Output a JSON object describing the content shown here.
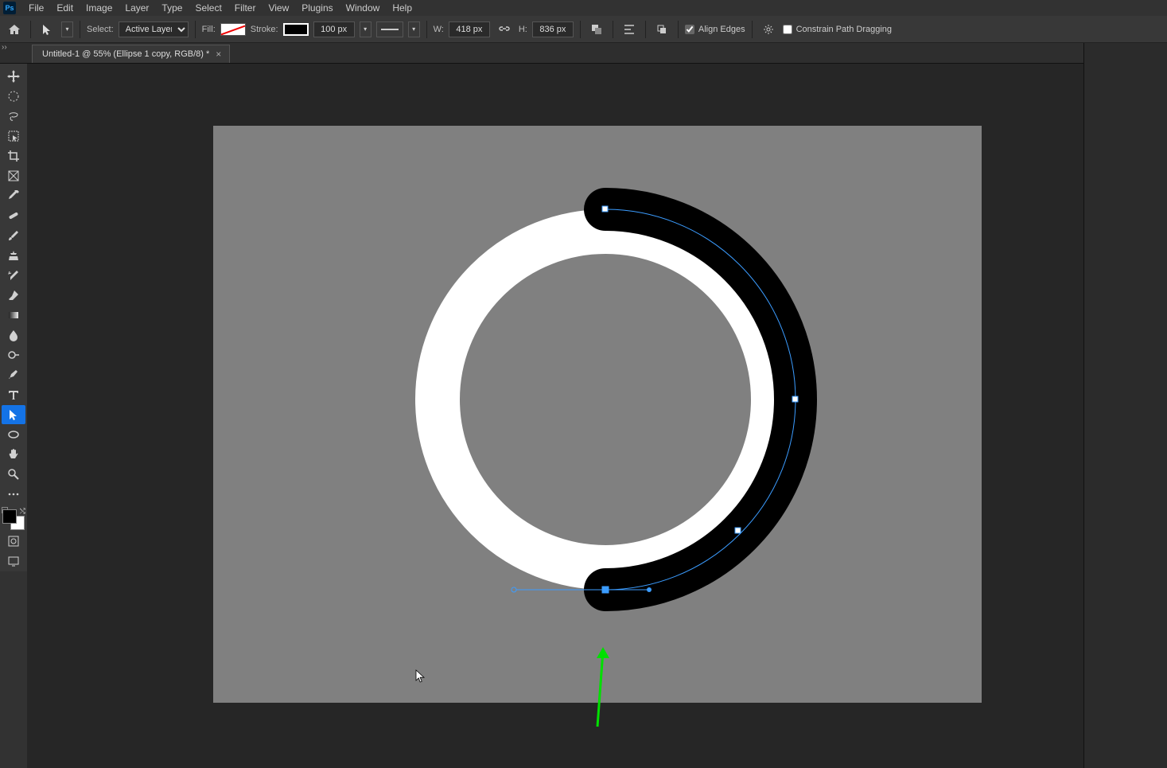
{
  "menu": {
    "items": [
      "File",
      "Edit",
      "Image",
      "Layer",
      "Type",
      "Select",
      "Filter",
      "View",
      "Plugins",
      "Window",
      "Help"
    ]
  },
  "options": {
    "select_label": "Select:",
    "select_value": "Active Layers",
    "fill_label": "Fill:",
    "stroke_label": "Stroke:",
    "stroke_width": "100 px",
    "w_label": "W:",
    "w_value": "418 px",
    "h_label": "H:",
    "h_value": "836 px",
    "align_edges": "Align Edges",
    "constrain": "Constrain Path Dragging"
  },
  "tab": {
    "title": "Untitled-1 @ 55% (Ellipse 1 copy, RGB/8) *"
  },
  "tools": [
    "move",
    "marquee",
    "lasso",
    "wand",
    "crop",
    "frame",
    "eyedropper",
    "heal",
    "brush",
    "stamp",
    "history",
    "eraser",
    "gradient",
    "blur",
    "dodge",
    "pen",
    "type",
    "path-select",
    "shape",
    "hand",
    "zoom",
    "more"
  ],
  "active_tool_index": 17
}
